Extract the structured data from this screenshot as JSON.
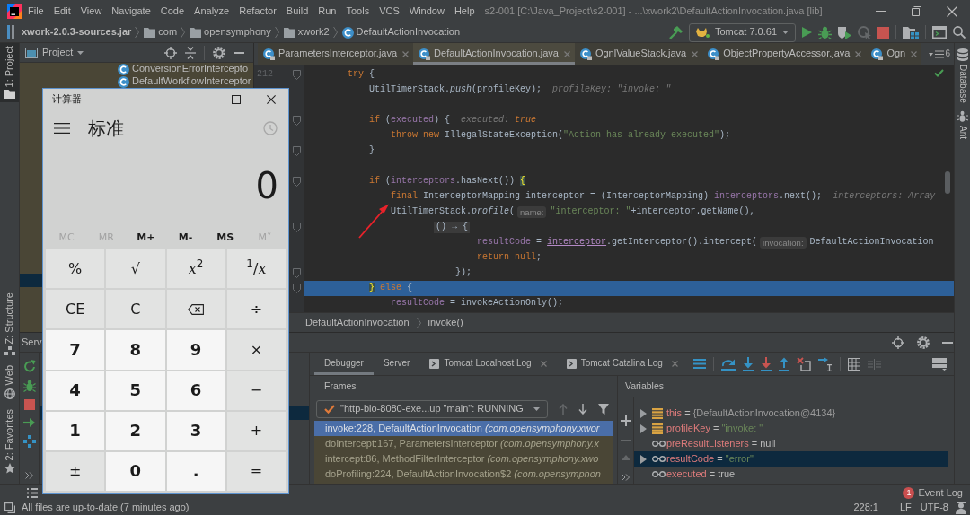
{
  "menu_bar": {
    "items": [
      "File",
      "Edit",
      "View",
      "Navigate",
      "Code",
      "Analyze",
      "Refactor",
      "Build",
      "Run",
      "Tools",
      "VCS",
      "Window",
      "Help"
    ],
    "title": "s2-001 [C:\\Java_Project\\s2-001] - ...\\xwork2\\DefaultActionInvocation.java [lib]"
  },
  "breadcrumbs": [
    {
      "kind": "jar",
      "label": "xwork-2.0.3-sources.jar"
    },
    {
      "kind": "folder",
      "label": "com"
    },
    {
      "kind": "folder",
      "label": "opensymphony"
    },
    {
      "kind": "folder",
      "label": "xwork2"
    },
    {
      "kind": "class",
      "label": "DefaultActionInvocation"
    }
  ],
  "main_toolbar": [
    {
      "kind": "build",
      "disabled": false
    },
    {
      "kind": "run_config",
      "label": "Tomcat 7.0.61",
      "disabled": false
    },
    {
      "kind": "run",
      "disabled": false
    },
    {
      "kind": "debug",
      "disabled": false
    },
    {
      "kind": "coverage",
      "disabled": false
    },
    {
      "kind": "profile",
      "disabled": true
    },
    {
      "kind": "stop",
      "disabled": false
    },
    {
      "kind": "project_structure",
      "disabled": false
    },
    {
      "kind": "run_anything",
      "disabled": false
    },
    {
      "kind": "search",
      "disabled": false
    }
  ],
  "left_stripe": {
    "top": [
      {
        "kind": "project",
        "label": "1: Project",
        "selected": true
      }
    ],
    "bottom": [
      {
        "kind": "structure",
        "label": "Z: Structure",
        "selected": false
      },
      {
        "kind": "web",
        "label": "Web",
        "selected": false
      },
      {
        "kind": "favorites",
        "label": "2: Favorites",
        "selected": false
      }
    ]
  },
  "right_stripe": [
    {
      "kind": "database",
      "label": "Database"
    },
    {
      "kind": "ant",
      "label": "Ant"
    }
  ],
  "project": {
    "title": "Project",
    "tree": [
      {
        "label": "ConversionErrorIntercepto",
        "selected": false
      },
      {
        "label": "DefaultWorkflowInterceptor",
        "selected": false
      }
    ],
    "covered_selection": true
  },
  "editor": {
    "tabs": [
      {
        "label": "ParametersInterceptor.java",
        "selected": false
      },
      {
        "label": "DefaultActionInvocation.java",
        "selected": true
      },
      {
        "label": "OgnlValueStack.java",
        "selected": false
      },
      {
        "label": "ObjectPropertyAccessor.java",
        "selected": false
      },
      {
        "label": "Ogn",
        "selected": false
      }
    ],
    "tab_overflow": "6",
    "lines": [
      {
        "number": "212",
        "fold_marker": true,
        "current": false,
        "parts": [
          {
            "kind": "code",
            "tokens": [
              {
                "kind": "kw",
                "text": "        try"
              },
              {
                "kind": "id",
                "text": " {"
              }
            ]
          }
        ]
      },
      {
        "fold_marker": false,
        "current": false,
        "parts": [
          {
            "kind": "code",
            "tokens": [
              {
                "kind": "id",
                "text": "            UtilTimerStack."
              },
              {
                "kind": "static",
                "text": "push"
              },
              {
                "kind": "id",
                "text": "(profileKey);"
              }
            ]
          },
          {
            "kind": "inline_hint",
            "tokens": [
              {
                "kind": "hint",
                "text": "profileKey: \"invoke: \""
              }
            ]
          }
        ]
      },
      {
        "fold_marker": false,
        "current": false
      },
      {
        "fold_marker": true,
        "current": false,
        "parts": [
          {
            "kind": "code",
            "tokens": [
              {
                "kind": "kw",
                "text": "            if"
              },
              {
                "kind": "id",
                "text": " ("
              },
              {
                "kind": "field",
                "text": "executed"
              },
              {
                "kind": "id",
                "text": ") {"
              }
            ]
          },
          {
            "kind": "inline_hint",
            "tokens": [
              {
                "kind": "hint",
                "text": "executed: "
              },
              {
                "kind": "hint_value",
                "text": "true"
              }
            ]
          }
        ]
      },
      {
        "fold_marker": false,
        "current": false,
        "parts": [
          {
            "kind": "code",
            "tokens": [
              {
                "kind": "kw",
                "text": "                throw new"
              },
              {
                "kind": "id",
                "text": " IllegalStateException("
              },
              {
                "kind": "str",
                "text": "\"Action has already executed\""
              },
              {
                "kind": "id",
                "text": ");"
              }
            ]
          }
        ]
      },
      {
        "fold_marker": true,
        "current": false,
        "parts": [
          {
            "kind": "code",
            "tokens": [
              {
                "kind": "id",
                "text": "            }"
              }
            ]
          }
        ]
      },
      {
        "fold_marker": false,
        "current": false
      },
      {
        "fold_marker": true,
        "current": false,
        "parts": [
          {
            "kind": "code",
            "tokens": [
              {
                "kind": "kw",
                "text": "            if"
              },
              {
                "kind": "id",
                "text": " ("
              },
              {
                "kind": "field",
                "text": "interceptors"
              },
              {
                "kind": "id",
                "text": ".hasNext()) "
              },
              {
                "kind": "brace",
                "text": "{"
              }
            ]
          }
        ]
      },
      {
        "fold_marker": false,
        "current": false,
        "parts": [
          {
            "kind": "code",
            "tokens": [
              {
                "kind": "kw",
                "text": "                final"
              },
              {
                "kind": "id",
                "text": " InterceptorMapping interceptor = (InterceptorMapping) "
              },
              {
                "kind": "field",
                "text": "interceptors"
              },
              {
                "kind": "id",
                "text": ".next();"
              }
            ]
          },
          {
            "kind": "inline_hint",
            "tokens": [
              {
                "kind": "hint",
                "text": "interceptors: Array"
              }
            ]
          }
        ]
      },
      {
        "fold_marker": false,
        "current": false,
        "parts": [
          {
            "kind": "code",
            "tokens": [
              {
                "kind": "id",
                "text": "                UtilTimerStack."
              },
              {
                "kind": "static",
                "text": "profile"
              },
              {
                "kind": "id",
                "text": "("
              }
            ]
          },
          {
            "kind": "param_hint",
            "text": "name:"
          },
          {
            "kind": "code",
            "tokens": [
              {
                "kind": "str",
                "text": "\"interceptor: \""
              },
              {
                "kind": "id",
                "text": "+interceptor.getName(),"
              }
            ]
          }
        ]
      },
      {
        "fold_marker": true,
        "current": false,
        "parts": [
          {
            "kind": "fold",
            "text": "                        () → {"
          }
        ]
      },
      {
        "fold_marker": false,
        "current": false,
        "parts": [
          {
            "kind": "code",
            "tokens": [
              {
                "kind": "field",
                "text": "                                resultCode"
              },
              {
                "kind": "id",
                "text": " = "
              },
              {
                "kind": "captured",
                "text": "interceptor"
              },
              {
                "kind": "id",
                "text": ".getInterceptor().intercept("
              }
            ]
          },
          {
            "kind": "param_hint",
            "text": "invocation:"
          },
          {
            "kind": "code",
            "tokens": [
              {
                "kind": "id",
                "text": "DefaultActionInvocation"
              }
            ]
          }
        ]
      },
      {
        "fold_marker": false,
        "current": false,
        "parts": [
          {
            "kind": "code",
            "tokens": [
              {
                "kind": "kw",
                "text": "                                return null"
              },
              {
                "kind": "id",
                "text": ";"
              }
            ]
          }
        ]
      },
      {
        "fold_marker": true,
        "current": false,
        "parts": [
          {
            "kind": "code",
            "tokens": [
              {
                "kind": "id",
                "text": "                            });"
              }
            ]
          }
        ]
      },
      {
        "fold_marker": true,
        "current": true,
        "parts": [
          {
            "kind": "code",
            "tokens": [
              {
                "kind": "brace",
                "text": "            }"
              },
              {
                "kind": "kw",
                "text": " else"
              },
              {
                "kind": "id",
                "text": " {"
              }
            ]
          }
        ]
      },
      {
        "fold_marker": false,
        "current": false,
        "parts": [
          {
            "kind": "code",
            "tokens": [
              {
                "kind": "field",
                "text": "                resultCode"
              },
              {
                "kind": "id",
                "text": " = invokeActionOnly();"
              }
            ]
          }
        ]
      }
    ],
    "breadcrumbs": [
      "DefaultActionInvocation",
      "invoke()"
    ],
    "annotations": [
      {
        "kind": "arrow"
      }
    ]
  },
  "services": {
    "title": "Serv",
    "covered_selection": true
  },
  "debugger": {
    "tabs": [
      {
        "kind": "plain",
        "label": "Debugger",
        "selected": true
      },
      {
        "kind": "plain",
        "label": "Server",
        "selected": false
      },
      {
        "kind": "log",
        "label": "Tomcat Localhost Log",
        "selected": false
      },
      {
        "kind": "log",
        "label": "Tomcat Catalina Log",
        "selected": false
      }
    ],
    "toolbar": [
      {
        "kind": "frames_list",
        "disabled": false
      },
      {
        "kind": "step_over",
        "disabled": false
      },
      {
        "kind": "step_into",
        "disabled": false
      },
      {
        "kind": "force_step_into",
        "disabled": false
      },
      {
        "kind": "step_out",
        "disabled": false
      },
      {
        "kind": "drop_frame",
        "disabled": false
      },
      {
        "kind": "run_to_cursor",
        "disabled": false
      },
      {
        "kind": "evaluate",
        "disabled": false
      },
      {
        "kind": "trace",
        "disabled": true
      },
      {
        "kind": "layout",
        "disabled": false
      }
    ],
    "frames": {
      "title": "Frames",
      "thread": "\"http-bio-8080-exe...up \"main\": RUNNING",
      "nav": [
        {
          "kind": "up",
          "disabled": true
        },
        {
          "kind": "down",
          "disabled": false
        },
        {
          "kind": "filter",
          "disabled": false
        }
      ],
      "items": [
        {
          "text": "invoke:228, DefaultActionInvocation *(com.opensymphony.xwor*",
          "selected": true
        },
        {
          "text": "doIntercept:167, ParametersInterceptor *(com.opensymphony.x*",
          "selected": false
        },
        {
          "text": "intercept:86, MethodFilterInterceptor *(com.opensymphony.xwo*",
          "selected": false
        },
        {
          "text": "doProfiling:224, DefaultActionInvocation$2 *(com.opensymphon*",
          "selected": false
        }
      ]
    },
    "variables": {
      "title": "Variables",
      "toolbar": [
        {
          "kind": "add",
          "disabled": false
        },
        {
          "kind": "remove",
          "disabled": true
        },
        {
          "kind": "move_up",
          "disabled": true
        },
        {
          "kind": "more",
          "disabled": false
        }
      ],
      "items": [
        {
          "kind": "object",
          "expandable": true,
          "selected": false,
          "tokens": [
            {
              "kind": "name",
              "text": "this"
            },
            {
              "kind": "op",
              "text": " = "
            },
            {
              "kind": "ref",
              "text": "{DefaultActionInvocation@4134}"
            }
          ]
        },
        {
          "kind": "object",
          "expandable": true,
          "selected": false,
          "tokens": [
            {
              "kind": "name",
              "text": "profileKey"
            },
            {
              "kind": "op",
              "text": " = "
            },
            {
              "kind": "string",
              "text": "\"invoke: \""
            }
          ]
        },
        {
          "kind": "value",
          "expandable": false,
          "selected": false,
          "tokens": [
            {
              "kind": "name",
              "text": "preResultListeners"
            },
            {
              "kind": "op",
              "text": " = null"
            }
          ]
        },
        {
          "kind": "value",
          "expandable": true,
          "selected": true,
          "tokens": [
            {
              "kind": "name",
              "text": "resultCode"
            },
            {
              "kind": "op",
              "text": " = "
            },
            {
              "kind": "string",
              "text": "\"error\""
            }
          ]
        },
        {
          "kind": "value",
          "expandable": false,
          "selected": false,
          "tokens": [
            {
              "kind": "name",
              "text": "executed"
            },
            {
              "kind": "op",
              "text": " = true"
            }
          ]
        }
      ]
    }
  },
  "event_log": {
    "label": "Event Log",
    "badge": "1"
  },
  "status_bar": {
    "message": "All files are up-to-date (7 minutes ago)",
    "position": "228:1",
    "line_separator": "LF",
    "encoding": "UTF-8"
  },
  "calculator": {
    "title": "计算器",
    "mode": "标准",
    "history_button": {
      "disabled": true
    },
    "display": "0",
    "memory": [
      {
        "label": "MC",
        "disabled": true
      },
      {
        "label": "MR",
        "disabled": true
      },
      {
        "label": "M+",
        "disabled": false
      },
      {
        "label": "M-",
        "disabled": false
      },
      {
        "label": "MS",
        "disabled": false
      },
      {
        "label": "M˅",
        "disabled": true
      }
    ],
    "keys": [
      {
        "kind": "function",
        "label": "%"
      },
      {
        "kind": "function",
        "label": "√"
      },
      {
        "kind": "function",
        "label": "*x*$^{2}$"
      },
      {
        "kind": "function",
        "label": "$^{1}$/*x*"
      },
      {
        "kind": "function",
        "label": "CE"
      },
      {
        "kind": "function",
        "label": "C"
      },
      {
        "kind": "backspace"
      },
      {
        "kind": "function",
        "label": "÷"
      },
      {
        "kind": "digit",
        "label": "7"
      },
      {
        "kind": "digit",
        "label": "8"
      },
      {
        "kind": "digit",
        "label": "9"
      },
      {
        "kind": "function",
        "label": "×"
      },
      {
        "kind": "digit",
        "label": "4"
      },
      {
        "kind": "digit",
        "label": "5"
      },
      {
        "kind": "digit",
        "label": "6"
      },
      {
        "kind": "function",
        "label": "−"
      },
      {
        "kind": "digit",
        "label": "1"
      },
      {
        "kind": "digit",
        "label": "2"
      },
      {
        "kind": "digit",
        "label": "3"
      },
      {
        "kind": "function",
        "label": "+"
      },
      {
        "kind": "function",
        "label": "±"
      },
      {
        "kind": "digit",
        "label": "0"
      },
      {
        "kind": "digit",
        "label": "."
      },
      {
        "kind": "function",
        "label": "="
      }
    ]
  }
}
